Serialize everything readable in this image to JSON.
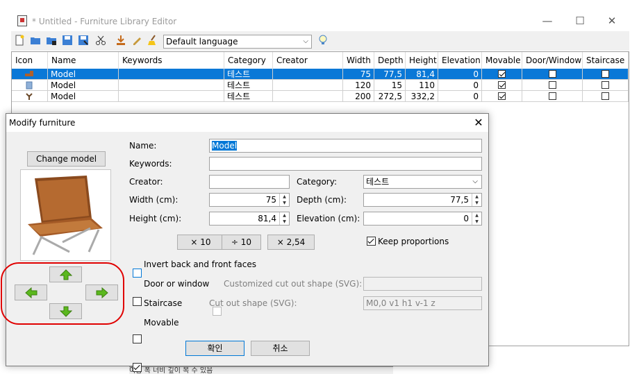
{
  "window": {
    "title": "* Untitled - Furniture Library Editor",
    "minimize": "—",
    "maximize": "☐",
    "close": "✕"
  },
  "toolbar": {
    "language": "Default language",
    "icons": [
      "new-icon",
      "open-icon",
      "add-icon",
      "save-icon",
      "save-as-icon",
      "cut-icon",
      "import-icon",
      "edit-icon",
      "clean-icon",
      "tip-icon"
    ]
  },
  "table": {
    "headers": [
      "Icon",
      "Name",
      "Keywords",
      "Category",
      "Creator",
      "Width",
      "Depth",
      "Height",
      "Elevation",
      "Movable",
      "Door/Window",
      "Staircase"
    ],
    "rows": [
      {
        "name": "Model",
        "keywords": "",
        "category": "테스트",
        "creator": "",
        "width": "75",
        "depth": "77,5",
        "height": "81,4",
        "elevation": "0",
        "movable": true,
        "door_window": false,
        "staircase": false
      },
      {
        "name": "Model",
        "keywords": "",
        "category": "테스트",
        "creator": "",
        "width": "120",
        "depth": "15",
        "height": "110",
        "elevation": "0",
        "movable": true,
        "door_window": false,
        "staircase": false
      },
      {
        "name": "Model",
        "keywords": "",
        "category": "테스트",
        "creator": "",
        "width": "200",
        "depth": "272,5",
        "height": "332,2",
        "elevation": "0",
        "movable": true,
        "door_window": false,
        "staircase": false
      }
    ]
  },
  "dialog": {
    "title": "Modify furniture",
    "change_model": "Change model",
    "name_label": "Name:",
    "name_value": "Model",
    "keywords_label": "Keywords:",
    "keywords_value": "",
    "creator_label": "Creator:",
    "creator_value": "",
    "category_label": "Category:",
    "category_value": "테스트",
    "width_label": "Width (cm):",
    "width_value": "75",
    "depth_label": "Depth (cm):",
    "depth_value": "77,5",
    "height_label": "Height (cm):",
    "height_value": "81,4",
    "elevation_label": "Elevation (cm):",
    "elevation_value": "0",
    "mult10": "× 10",
    "div10": "÷ 10",
    "mult254": "× 2,54",
    "keep_proportions": "Keep proportions",
    "invert_faces": "Invert back and front faces",
    "door_or_window": "Door or window",
    "custom_cutout": "Customized cut out shape (SVG):",
    "custom_cutout_value": "",
    "staircase": "Staircase",
    "cutout_shape": "Cut out shape (SVG):",
    "cutout_shape_value": "M0,0 v1 h1 v-1 z",
    "movable": "Movable",
    "ok": "확인",
    "cancel": "취소"
  },
  "colors": {
    "selection": "#0a78d7",
    "highlight_circle": "#e00000",
    "arrow_green": "#5bb81e"
  },
  "bottom_strip": "이름          폭     너비    깊이    복 수 있음"
}
